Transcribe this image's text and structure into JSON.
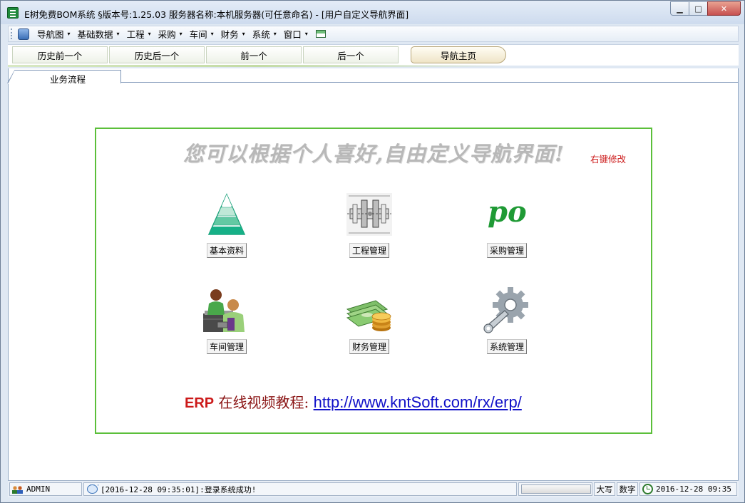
{
  "window": {
    "title": "E树免费BOM系统 §版本号:1.25.03  服务器名称:本机服务器(可任意命名) - [用户自定义导航界面]",
    "controls": {
      "minimize": "▁",
      "maximize": "□",
      "close": "✕"
    }
  },
  "menu": {
    "items": [
      {
        "label": "导航图",
        "arrow": "▾"
      },
      {
        "label": "基础数据",
        "arrow": "▾"
      },
      {
        "label": "工程",
        "arrow": "▾"
      },
      {
        "label": "采购",
        "arrow": "▾"
      },
      {
        "label": "车间",
        "arrow": "▾"
      },
      {
        "label": "财务",
        "arrow": "▾"
      },
      {
        "label": "系统",
        "arrow": "▾"
      },
      {
        "label": "窗口",
        "arrow": "▾"
      }
    ]
  },
  "nav": {
    "history_back": "历史前一个",
    "history_forward": "历史后一个",
    "previous": "前一个",
    "next": "后一个",
    "home": "导航主页"
  },
  "tab": {
    "label": "业务流程"
  },
  "panel": {
    "slogan": "您可以根据个人喜好,自由定义导航界面!",
    "edit_hint": "右键修改",
    "modules": [
      {
        "label": "基本资料",
        "icon": "pyramid-icon"
      },
      {
        "label": "工程管理",
        "icon": "engineering-drawing-icon"
      },
      {
        "label": "采购管理",
        "icon": "po-icon"
      },
      {
        "label": "车间管理",
        "icon": "workers-icon"
      },
      {
        "label": "财务管理",
        "icon": "money-coins-icon"
      },
      {
        "label": "系统管理",
        "icon": "gear-wrench-icon"
      }
    ],
    "po_text": "po",
    "erp_prefix": "ERP",
    "erp_text": " 在线视频教程: ",
    "erp_url": "http://www.kntSoft.com/rx/erp/"
  },
  "status": {
    "user": "ADMIN",
    "message": "[2016-12-28 09:35:01]:登录系统成功!",
    "progress": 0,
    "caps": "大写",
    "num": "数字",
    "datetime": "2016-12-28 09:35"
  },
  "colors": {
    "panel_border": "#5bbf3a",
    "link": "#1010c8",
    "accent_red": "#cc1a1a"
  }
}
